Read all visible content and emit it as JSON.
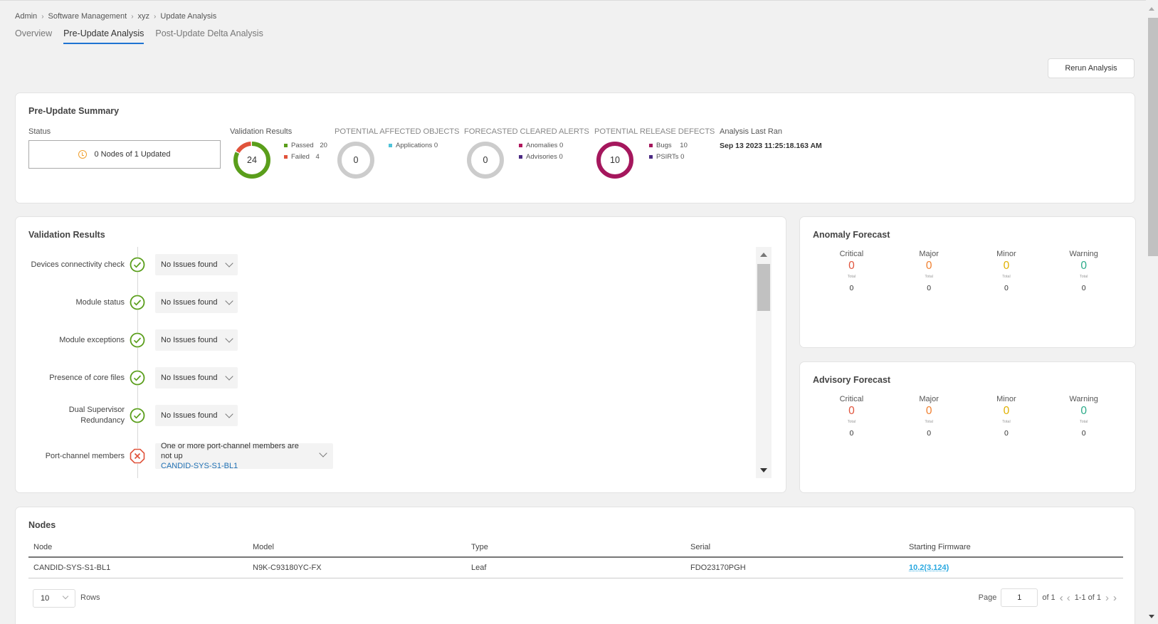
{
  "breadcrumb": [
    "Admin",
    "Software Management",
    "xyz",
    "Update Analysis"
  ],
  "tabs": [
    {
      "label": "Overview",
      "active": false
    },
    {
      "label": "Pre-Update Analysis",
      "active": true
    },
    {
      "label": "Post-Update Delta Analysis",
      "active": false
    }
  ],
  "rerun_label": "Rerun Analysis",
  "summary": {
    "title": "Pre-Update Summary",
    "status_label": "Status",
    "status_text": "0 Nodes of 1 Updated",
    "validation": {
      "caption": "Validation Results",
      "total": "24",
      "legend": [
        {
          "label": "Passed",
          "value": "20",
          "value_num": 20,
          "color": "#5a9e1b"
        },
        {
          "label": "Failed",
          "value": "4",
          "value_num": 4,
          "color": "#e0533b"
        }
      ]
    },
    "affected": {
      "caption": "POTENTIAL AFFECTED OBJECTS",
      "total": "0",
      "legend": [
        {
          "label": "Applications",
          "value": "0",
          "color": "#4fc3d9"
        }
      ]
    },
    "cleared": {
      "caption": "FORECASTED CLEARED ALERTS",
      "total": "0",
      "legend": [
        {
          "label": "Anomalies",
          "value": "0",
          "color": "#b0175d"
        },
        {
          "label": "Advisories",
          "value": "0",
          "color": "#4b2a83"
        }
      ]
    },
    "defects": {
      "caption": "POTENTIAL RELEASE DEFECTS",
      "total": "10",
      "ring_color": "#a5175d",
      "legend": [
        {
          "label": "Bugs",
          "value": "10",
          "color": "#a5175d"
        },
        {
          "label": "PSIRTs",
          "value": "0",
          "color": "#4b2a83"
        }
      ]
    },
    "last_ran_label": "Analysis Last Ran",
    "last_ran_value": "Sep 13 2023 11:25:18.163 AM",
    "empty_ring_color": "#cccccc"
  },
  "validation": {
    "title": "Validation Results",
    "items": [
      {
        "name": "Devices connectivity check",
        "status": "pass",
        "result": "No Issues found"
      },
      {
        "name": "Module status",
        "status": "pass",
        "result": "No Issues found"
      },
      {
        "name": "Module exceptions",
        "status": "pass",
        "result": "No Issues found"
      },
      {
        "name": "Presence of core files",
        "status": "pass",
        "result": "No Issues found"
      },
      {
        "name": "Dual Supervisor Redundancy",
        "status": "pass",
        "result": "No Issues found"
      },
      {
        "name": "Port-channel members",
        "status": "fail",
        "result": "One or more port-channel members are not up",
        "link": "CANDID-SYS-S1-BL1"
      }
    ]
  },
  "forecast_labels": [
    "Critical",
    "Major",
    "Minor",
    "Warning"
  ],
  "forecast_colors": [
    "#e0533b",
    "#f08030",
    "#e0b000",
    "#2aaa88"
  ],
  "total_label": "Total",
  "anomaly": {
    "title": "Anomaly Forecast",
    "values": [
      "0",
      "0",
      "0",
      "0"
    ],
    "subvalues": [
      "0",
      "0",
      "0",
      "0"
    ]
  },
  "advisory": {
    "title": "Advisory Forecast",
    "values": [
      "0",
      "0",
      "0",
      "0"
    ],
    "subvalues": [
      "0",
      "0",
      "0",
      "0"
    ]
  },
  "nodes": {
    "title": "Nodes",
    "columns": [
      "Node",
      "Model",
      "Type",
      "Serial",
      "Starting Firmware"
    ],
    "rows": [
      [
        "CANDID-SYS-S1-BL1",
        "N9K-C93180YC-FX",
        "Leaf",
        "FDO23170PGH",
        "10.2(3.124)"
      ]
    ],
    "rows_per_page": "10",
    "rows_label": "Rows",
    "page_label": "Page",
    "page_value": "1",
    "of_label": "of 1",
    "range_label": "1-1 of 1"
  }
}
